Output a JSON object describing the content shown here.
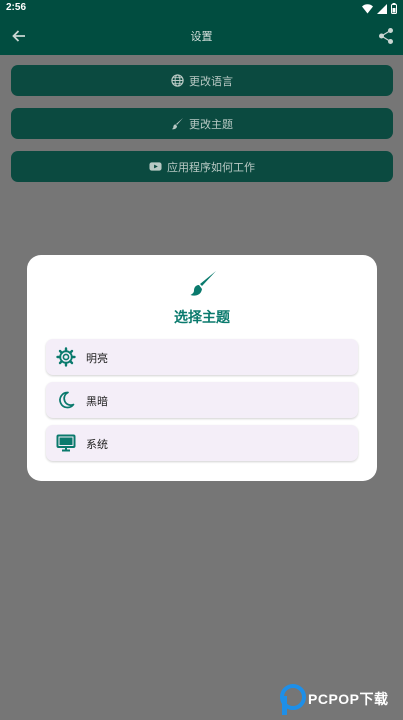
{
  "status_bar": {
    "time": "2:56"
  },
  "app_bar": {
    "title": "设置"
  },
  "menu": {
    "items": [
      {
        "label": "更改语言",
        "icon": "globe-icon"
      },
      {
        "label": "更改主题",
        "icon": "brush-icon"
      },
      {
        "label": "应用程序如何工作",
        "icon": "youtube-icon"
      }
    ]
  },
  "dialog": {
    "title": "选择主题",
    "icon": "brush-icon",
    "options": [
      {
        "label": "明亮",
        "icon": "gear-icon"
      },
      {
        "label": "黑暗",
        "icon": "moon-icon"
      },
      {
        "label": "系统",
        "icon": "monitor-icon"
      }
    ]
  },
  "watermark": {
    "text": "PCPOP下载"
  },
  "colors": {
    "primary": "#014d40",
    "accent": "#0a7a6d",
    "scrim": "#767676",
    "option_bg": "#f4eef8"
  }
}
